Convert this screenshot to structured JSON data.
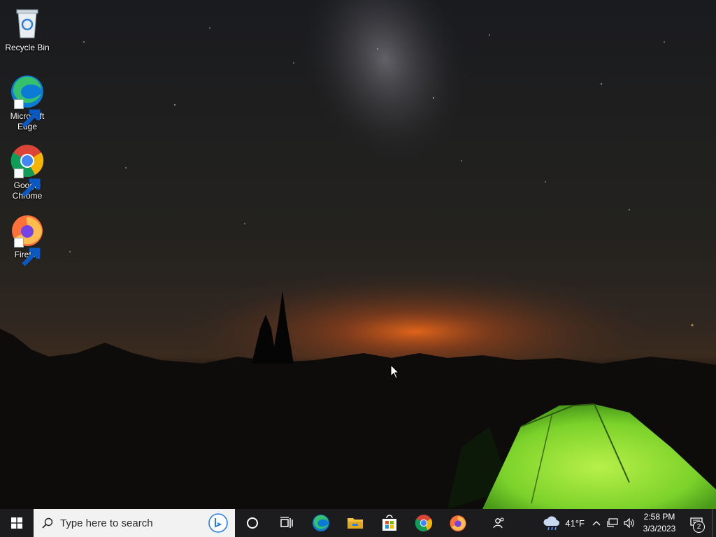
{
  "desktop": {
    "icons": [
      {
        "label": "Recycle Bin",
        "icon": "recycle-bin-icon"
      },
      {
        "label": "Microsoft Edge",
        "icon": "edge-icon"
      },
      {
        "label": "Google Chrome",
        "icon": "chrome-icon"
      },
      {
        "label": "Firefox",
        "icon": "firefox-icon"
      }
    ],
    "wallpaper": "night-sky-milky-way-tent"
  },
  "taskbar": {
    "start_icon": "windows-logo-icon",
    "search": {
      "placeholder": "Type here to search",
      "value": ""
    },
    "pinned": [
      {
        "name": "cortana",
        "icon": "cortana-icon"
      },
      {
        "name": "task-view",
        "icon": "task-view-icon"
      },
      {
        "name": "edge",
        "icon": "edge-icon"
      },
      {
        "name": "file-explorer",
        "icon": "folder-icon"
      },
      {
        "name": "store",
        "icon": "store-icon"
      },
      {
        "name": "chrome",
        "icon": "chrome-icon"
      },
      {
        "name": "firefox",
        "icon": "firefox-icon"
      },
      {
        "name": "people",
        "icon": "people-icon"
      }
    ],
    "weather": {
      "temp": "41°F",
      "icon": "cloud-rain-icon"
    },
    "tray_icons": [
      "chevron-up-icon",
      "network-icon",
      "volume-icon"
    ],
    "clock": {
      "time": "2:58 PM",
      "date": "3/3/2023"
    },
    "notifications": {
      "count": "2",
      "icon": "action-center-icon"
    }
  },
  "colors": {
    "taskbar": "#1c1c1f",
    "search_bg": "#f2f2f2",
    "tent_green": "#8fe23a",
    "horizon_orange": "#e0641a"
  }
}
